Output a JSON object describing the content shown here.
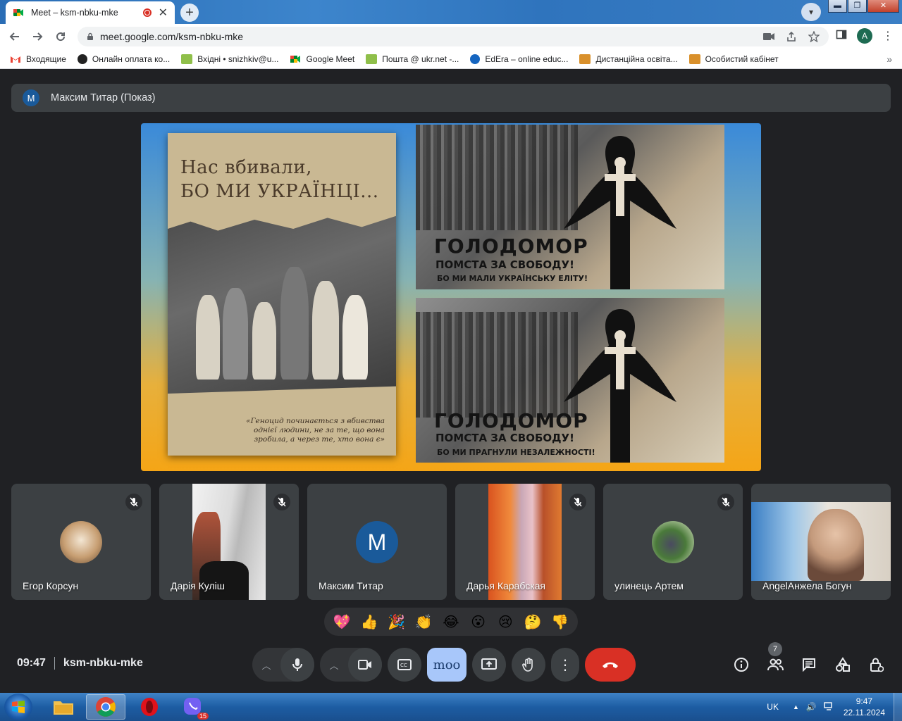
{
  "browser": {
    "tab_title": "Meet – ksm-nbku-mke",
    "url": "meet.google.com/ksm-nbku-mke",
    "profile_initial": "A",
    "bookmarks": [
      {
        "label": "Входящие",
        "icon": "gmail-icon"
      },
      {
        "label": "Онлайн оплата ко...",
        "icon": "24-icon"
      },
      {
        "label": "Вхідні • snizhkiv@u...",
        "icon": "mail-icon"
      },
      {
        "label": "Google Meet",
        "icon": "meet-icon"
      },
      {
        "label": "Пошта @ ukr.net -...",
        "icon": "mail-icon"
      },
      {
        "label": "EdEra – online educ...",
        "icon": "edera-icon"
      },
      {
        "label": "Дистанційна освіта...",
        "icon": "board-icon"
      },
      {
        "label": "Особистий кабінет",
        "icon": "board-icon"
      }
    ]
  },
  "meet": {
    "presenter": {
      "initial": "M",
      "label": "Максим Титар (Показ)"
    },
    "slide": {
      "book_title_line1": "Нас вбивали,",
      "book_title_line2": "БО МИ УКРАЇНЦІ...",
      "book_quote": "«Геноцид починається з вбивства однієї людини, не за те, що вона зробила, а через те, хто вона є»",
      "panel1_title": "ГОЛОДОМОР",
      "panel1_sub": "ПОМСТА ЗА СВОБОДУ!",
      "panel1_caption": "БО МИ МАЛИ УКРАЇНСЬКУ ЕЛІТУ!",
      "panel2_title": "ГОЛОДОМОР",
      "panel2_sub": "ПОМСТА ЗА СВОБОДУ!",
      "panel2_caption": "БО МИ ПРАГНУЛИ НЕЗАЛЕЖНОСТІ!"
    },
    "participants": [
      {
        "name": "Егор Корсун",
        "muted": true
      },
      {
        "name": "Дарія Куліш",
        "muted": true
      },
      {
        "name": "Максим Титар",
        "muted": false,
        "initial": "M"
      },
      {
        "name": "Дарья Карабская",
        "muted": true
      },
      {
        "name": "улинець Артем",
        "muted": true
      },
      {
        "name": "AngelАнжела Богун",
        "muted": false
      }
    ],
    "reactions": [
      "💖",
      "👍",
      "🎉",
      "👏",
      "😂",
      "😮",
      "😢",
      "🤔",
      "👎"
    ],
    "time": "09:47",
    "meeting_code": "ksm-nbku-mke",
    "effects_label": "moo",
    "people_count": "7"
  },
  "taskbar": {
    "lang": "UK",
    "time": "9:47",
    "date": "22.11.2024",
    "viber_badge": "15"
  },
  "colors": {
    "meet_bg": "#202124",
    "tile_bg": "#3c4043",
    "hangup": "#d93025",
    "avatar_blue": "#1a5a9a",
    "effects_btn": "#a8c7fa"
  }
}
